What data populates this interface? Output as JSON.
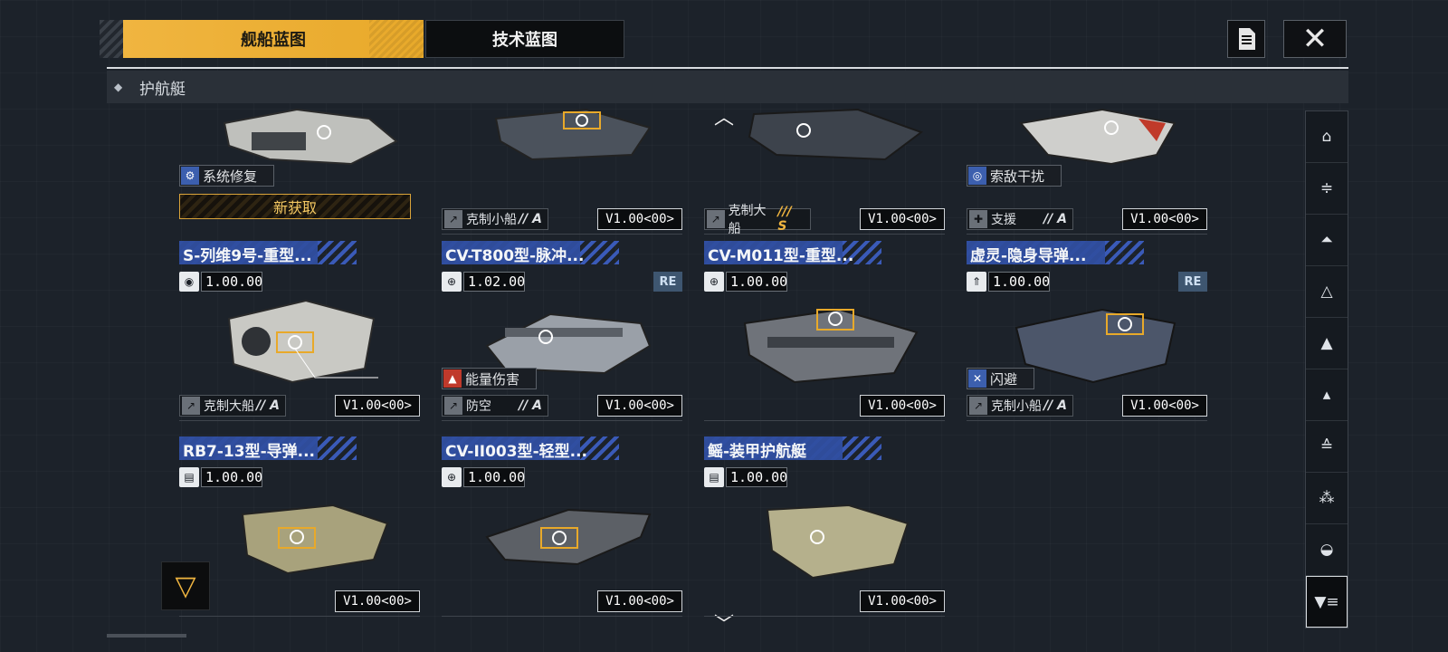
{
  "tabs": {
    "ship_blueprint": "舰船蓝图",
    "tech_blueprint": "技术蓝图"
  },
  "category": {
    "label": "护航艇",
    "icon": "escort-class-icon"
  },
  "accent_color": "#f0b540",
  "top_row": [
    {
      "skill": "系统修复",
      "skill_icon": "repair-icon",
      "new_label": "新获取"
    },
    {
      "role": "克制小船",
      "grade": "// A",
      "version": "V1.00<00>"
    },
    {
      "role": "克制大船",
      "grade": "/// S",
      "version": "V1.00<00>"
    },
    {
      "skill": "索敌干扰",
      "skill_icon": "jamming-icon",
      "role": "支援",
      "grade": "// A",
      "version": "V1.00<00>"
    }
  ],
  "cards": [
    {
      "name": "S-列维9号-重型...",
      "version_num": "1.00.00",
      "re": "",
      "skill": "",
      "role": "克制大船",
      "grade": "// A",
      "version": "V1.00<00>",
      "hull": "#c9c9c4"
    },
    {
      "name": "CV-T800型-脉冲...",
      "version_num": "1.02.00",
      "re": "RE",
      "skill": "能量伤害",
      "role": "防空",
      "grade": "// A",
      "version": "V1.00<00>",
      "hull": "#9aa0a8"
    },
    {
      "name": "CV-M011型-重型...",
      "version_num": "1.00.00",
      "re": "",
      "skill": "",
      "role": "",
      "grade": "",
      "version": "V1.00<00>",
      "hull": "#7c8088"
    },
    {
      "name": "虚灵-隐身导弹...",
      "version_num": "1.00.00",
      "re": "RE",
      "skill": "闪避",
      "role": "克制小船",
      "grade": "// A",
      "version": "V1.00<00>",
      "hull": "#4c566a"
    },
    {
      "name": "RB7-13型-导弹...",
      "version_num": "1.00.00",
      "re": "",
      "skill": "",
      "role": "",
      "grade": "",
      "version": "V1.00<00>",
      "hull": "#a8a27c"
    },
    {
      "name": "CV-II003型-轻型...",
      "version_num": "1.00.00",
      "re": "",
      "skill": "",
      "role": "",
      "grade": "",
      "version": "V1.00<00>",
      "hull": "#8a8e94"
    },
    {
      "name": "鳐-装甲护航艇",
      "version_num": "1.00.00",
      "re": "",
      "skill": "",
      "role": "",
      "grade": "",
      "version": "V1.00<00>",
      "hull": "#b5b08c"
    }
  ],
  "sidebar_icons": [
    "category-all-icon",
    "frigate-icon",
    "destroyer-icon",
    "cruiser-icon",
    "battlecruiser-icon",
    "capital-icon",
    "escort-icon",
    "carrier-icon",
    "aux-icon",
    "filter-icon"
  ]
}
